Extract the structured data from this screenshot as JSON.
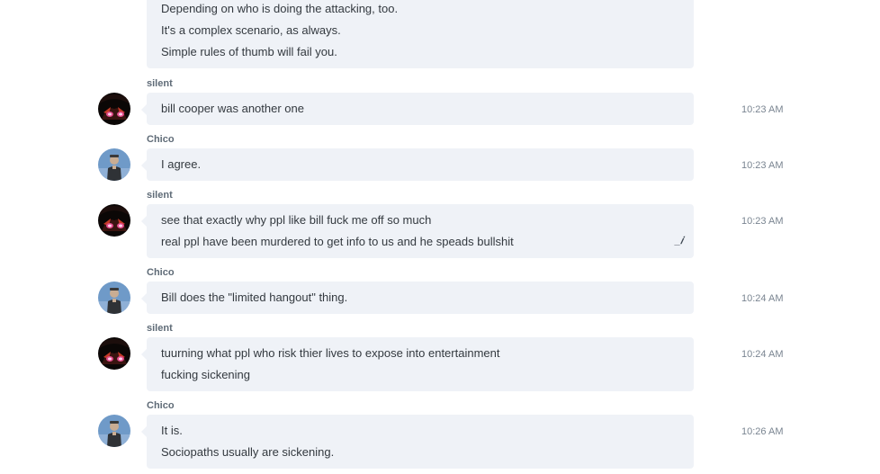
{
  "messages": [
    {
      "author": "",
      "lines": [
        "Depending on who is doing the attacking, too.",
        "It's a complex scenario, as always.",
        "Simple rules of thumb will fail you."
      ],
      "time": ""
    },
    {
      "author": "silent",
      "lines": [
        "bill cooper was another one"
      ],
      "time": "10:23 AM"
    },
    {
      "author": "Chico",
      "lines": [
        "I agree."
      ],
      "time": "10:23 AM"
    },
    {
      "author": "silent",
      "lines": [
        "see that exactly why ppl like bill fuck me off so much",
        "real ppl have been murdered to get info to us and he speads bullshit"
      ],
      "time": "10:23 AM",
      "edit_icon": "pencil-icon"
    },
    {
      "author": "Chico",
      "lines": [
        "Bill does the \"limited hangout\" thing."
      ],
      "time": "10:24 AM"
    },
    {
      "author": "silent",
      "lines": [
        "tuurning what ppl who risk thier lives to expose into entertainment",
        "fucking sickening"
      ],
      "time": "10:24 AM"
    },
    {
      "author": "Chico",
      "lines": [
        "It is.",
        "Sociopaths usually are sickening."
      ],
      "time": "10:26 AM"
    }
  ],
  "colors": {
    "bubble": "#eff2f7",
    "author": "#5f6b77",
    "text": "#33393f",
    "time": "#7a8591"
  }
}
